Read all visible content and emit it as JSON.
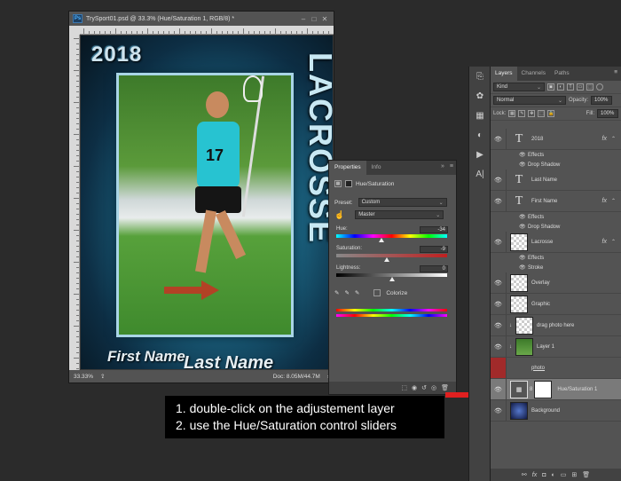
{
  "document": {
    "title": "TrySport01.psd @ 33.3% (Hue/Saturation 1, RGB/8) *",
    "ps_badge": "Ps",
    "zoom": "33.33%",
    "doc_info": "Doc: 8.05M/44.7M",
    "poster": {
      "year": "2018",
      "vertical_word": "LACROSSE",
      "jersey_number": "17",
      "first_name": "First Name",
      "last_name": "Last Name"
    }
  },
  "properties": {
    "tabs": [
      "Properties",
      "Info"
    ],
    "adjustment_title": "Hue/Saturation",
    "preset_label": "Preset:",
    "preset_value": "Custom",
    "channel_value": "Master",
    "hue_label": "Hue:",
    "hue_value": "-34",
    "saturation_label": "Saturation:",
    "saturation_value": "-9",
    "lightness_label": "Lightness:",
    "lightness_value": "0",
    "colorize_label": "Colorize",
    "hue_level": -34,
    "saturation_level": -9,
    "lightness_level": 0
  },
  "callout": {
    "line1": "1. double-click on the adjustement layer",
    "line2": "2. use the Hue/Saturation control sliders"
  },
  "layers_panel": {
    "tabs": [
      "Layers",
      "Channels",
      "Paths"
    ],
    "kind_label": "Kind",
    "blend_mode": "Normal",
    "opacity_label": "Opacity:",
    "opacity_value": "100%",
    "lock_label": "Lock:",
    "fill_label": "Fill:",
    "fill_value": "100%",
    "layers": [
      {
        "name": "2018",
        "kind": "text",
        "fx": true
      },
      {
        "name": "Effects",
        "kind": "sub"
      },
      {
        "name": "Drop Shadow",
        "kind": "sub"
      },
      {
        "name": "Last Name",
        "kind": "text"
      },
      {
        "name": "First Name",
        "kind": "text",
        "fx": true
      },
      {
        "name": "Effects",
        "kind": "sub"
      },
      {
        "name": "Drop Shadow",
        "kind": "sub"
      },
      {
        "name": "Lacrosse",
        "kind": "pixel",
        "fx": true
      },
      {
        "name": "Effects",
        "kind": "sub"
      },
      {
        "name": "Stroke",
        "kind": "sub"
      },
      {
        "name": "Overlay",
        "kind": "pixel"
      },
      {
        "name": "Graphic",
        "kind": "pixel"
      },
      {
        "name": "drag photo here",
        "kind": "pixel"
      },
      {
        "name": "Layer 1",
        "kind": "photo"
      },
      {
        "name": "photo",
        "kind": "hidden"
      },
      {
        "name": "Hue/Saturation 1",
        "kind": "adjustment"
      },
      {
        "name": "Background",
        "kind": "bg"
      }
    ]
  },
  "colors": {
    "panel": "#535353",
    "dark": "#2b2b2b",
    "arrow_red": "#e02020",
    "hidden_eye": "#a12a2a"
  }
}
